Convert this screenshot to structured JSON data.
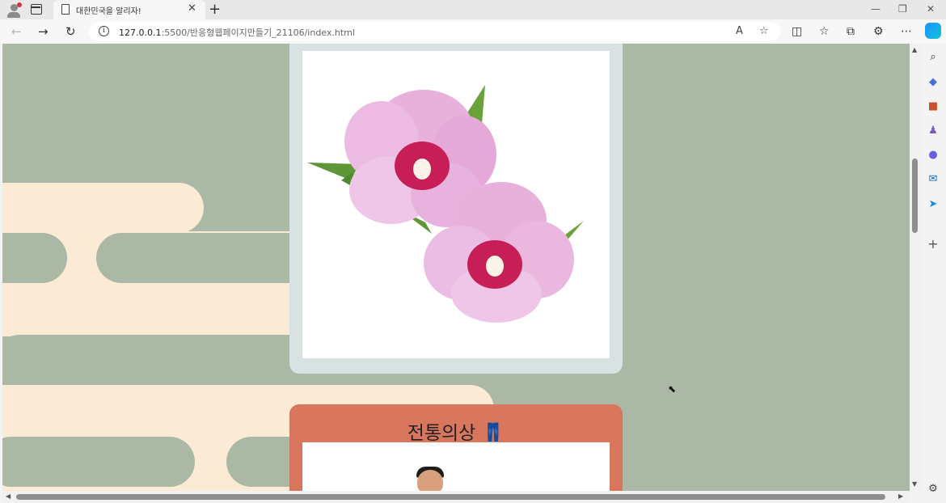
{
  "tab": {
    "title": "대한민국을 알리자!",
    "close": "✕",
    "new_tab": "+"
  },
  "window": {
    "minimize": "—",
    "restore": "❐",
    "close": "✕"
  },
  "address": {
    "host": "127.0.0.1",
    "path": ":5500/반응형웹페이지만들기_21106/index.html"
  },
  "nav": {
    "back": "←",
    "forward": "→",
    "reload": "↻"
  },
  "toolbar_icons": [
    "read-aloud-icon",
    "favorite-star-icon",
    "split-screen-icon",
    "favorites-icon",
    "collections-icon",
    "extensions-icon",
    "more-icon"
  ],
  "page": {
    "clothing_heading": "전통의상 👖"
  },
  "colors": {
    "page_bg": "#abb8a5",
    "cream": "#fbebd5",
    "flower_card": "#d8e2e3",
    "clothing_card": "#d9765e"
  }
}
